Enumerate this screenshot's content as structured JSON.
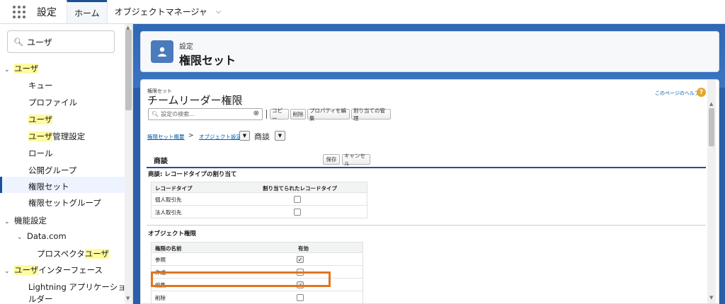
{
  "topbar": {
    "app_name": "設定",
    "tabs": [
      {
        "label": "ホーム",
        "active": true
      },
      {
        "label": "オブジェクトマネージャ",
        "active": false
      }
    ]
  },
  "sidebar": {
    "search_value": "ユーザ",
    "items": [
      {
        "label": "ユーザ",
        "level": 0,
        "expanded": true,
        "highlight": "full"
      },
      {
        "label": "キュー",
        "level": 1
      },
      {
        "label": "プロファイル",
        "level": 1
      },
      {
        "label": "ユーザ",
        "level": 1,
        "highlight": "full"
      },
      {
        "label_hl": "ユーザ",
        "label_rest": "管理設定",
        "level": 1
      },
      {
        "label": "ロール",
        "level": 1
      },
      {
        "label": "公開グループ",
        "level": 1
      },
      {
        "label": "権限セット",
        "level": 1,
        "selected": true
      },
      {
        "label": "権限セットグループ",
        "level": 1
      },
      {
        "label": "機能設定",
        "level": 0,
        "expanded": true
      },
      {
        "label": "Data.com",
        "level": 1,
        "expanded": true
      },
      {
        "label_rest_pre": "プロスペクタ",
        "label_hl": "ユーザ",
        "level": 2
      },
      {
        "label_hl": "ユーザ",
        "label_rest": "インターフェース",
        "level": 0,
        "expanded": true
      },
      {
        "label": "Lightning アプリケーションビ",
        "label2": "ルダー",
        "level": 1
      }
    ]
  },
  "header": {
    "eyebrow": "設定",
    "title": "権限セット"
  },
  "content": {
    "eyebrow": "権限セット",
    "title": "チームリーダー権限",
    "help_link": "このページのヘルプ",
    "search_placeholder": "設定の検索...",
    "buttons": {
      "copy": "コピー",
      "delete": "削除",
      "edit_props": "プロパティを編集",
      "manage_assign": "割り当ての管理",
      "save": "保存",
      "cancel": "キャンセル"
    },
    "breadcrumb": {
      "overview": "権限セット概要",
      "sep": ">",
      "object_settings": "オブジェクト設定",
      "current": "商談"
    },
    "section_title": "商談",
    "record_types": {
      "heading": "商談: レコードタイプの割り当て",
      "col_type": "レコードタイプ",
      "col_assigned": "割り当てられたレコードタイプ",
      "rows": [
        {
          "name": "個人取引先",
          "checked": false
        },
        {
          "name": "法人取引先",
          "checked": false
        }
      ]
    },
    "object_perms": {
      "heading": "オブジェクト権限",
      "col_name": "権限の名前",
      "col_enabled": "有効",
      "rows": [
        {
          "name": "参照",
          "checked": true
        },
        {
          "name": "作成",
          "checked": false
        },
        {
          "name": "編集",
          "checked": true
        },
        {
          "name": "削除",
          "checked": false
        }
      ]
    }
  },
  "colors": {
    "brand_blue": "#1b5297",
    "highlight": "#fffb9e",
    "annotation_orange": "#e0761f"
  }
}
